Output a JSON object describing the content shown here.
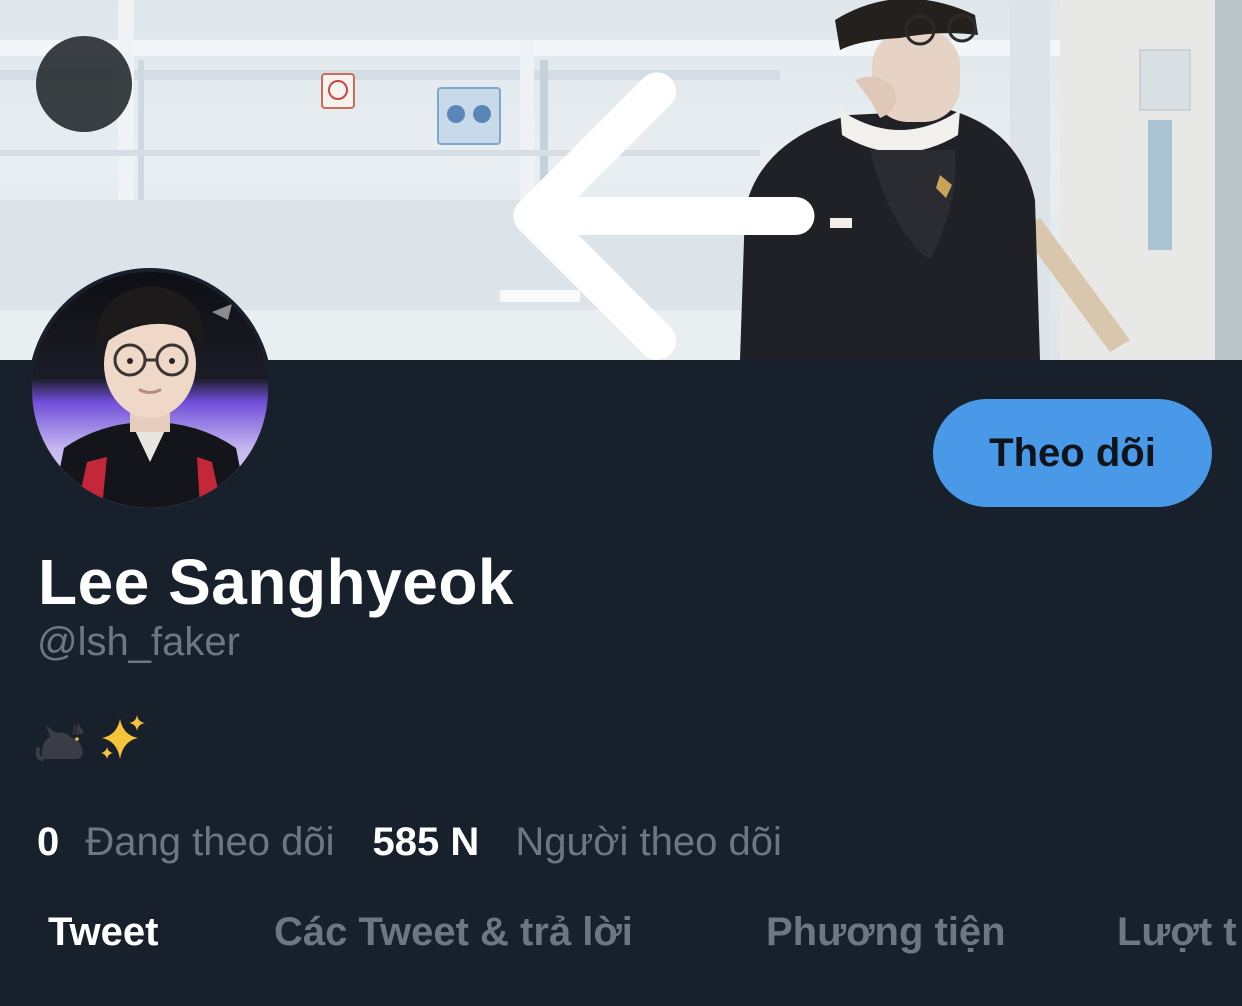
{
  "header": {
    "back_icon": "arrow-left-icon"
  },
  "profile": {
    "display_name": "Lee Sanghyeok",
    "handle": "@lsh_faker",
    "bio_emojis": [
      "black-cat-emoji",
      "sparkles-emoji"
    ],
    "follow_button_label": "Theo dõi"
  },
  "stats": {
    "following_count": "0",
    "following_label": "Đang theo dõi",
    "followers_count": "585 N",
    "followers_label": "Người theo dõi"
  },
  "tabs": [
    {
      "label": "Tweet",
      "active": true
    },
    {
      "label": "Các Tweet & trả lời",
      "active": false
    },
    {
      "label": "Phương tiện",
      "active": false
    },
    {
      "label": "Lượt t",
      "active": false
    }
  ],
  "colors": {
    "background": "#17202b",
    "accent": "#4a99e9",
    "primary_text": "#ffffff",
    "secondary_text": "#6e7781"
  }
}
